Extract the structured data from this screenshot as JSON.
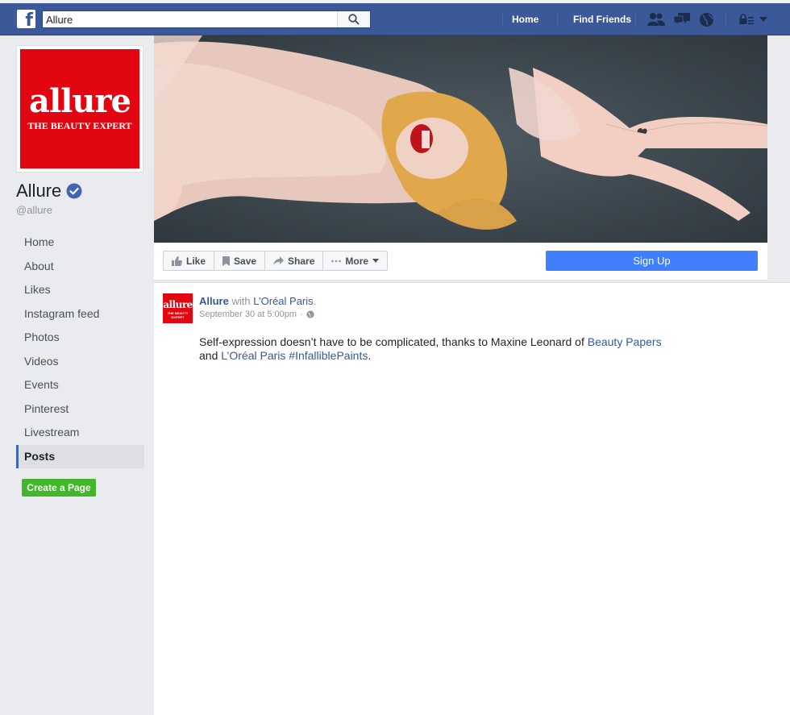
{
  "navbar": {
    "search_value": "Allure",
    "links": {
      "home": "Home",
      "find_friends": "Find Friends"
    }
  },
  "page": {
    "logo_word": "allure",
    "logo_tagline": "THE BEAUTY EXPERT",
    "name": "Allure",
    "handle": "@allure"
  },
  "sidebar": {
    "items": [
      {
        "label": "Home",
        "active": false
      },
      {
        "label": "About",
        "active": false
      },
      {
        "label": "Likes",
        "active": false
      },
      {
        "label": "Instagram feed",
        "active": false
      },
      {
        "label": "Photos",
        "active": false
      },
      {
        "label": "Videos",
        "active": false
      },
      {
        "label": "Events",
        "active": false
      },
      {
        "label": "Pinterest",
        "active": false
      },
      {
        "label": "Livestream",
        "active": false
      },
      {
        "label": "Posts",
        "active": true
      }
    ],
    "create_page": "Create a Page"
  },
  "actions": {
    "like": "Like",
    "save": "Save",
    "share": "Share",
    "more": "More",
    "signup": "Sign Up"
  },
  "post": {
    "author": "Allure",
    "with_text": "with",
    "tagged": "L’Oréal Paris",
    "time": "September 30 at 5:00pm",
    "body_1": "Self-expression doesn’t have to be complicated, thanks to Maxine Leonard of ",
    "body_link_1": "Beauty Papers",
    "body_2": "and ",
    "body_link_2": "L’Oréal Paris",
    "body_link_3": "#InfalliblePaints",
    "body_end": "."
  },
  "colors": {
    "brand_blue": "#3b5998",
    "allure_red": "#e20611",
    "signup_blue": "#4080ff",
    "create_green": "#42b72a"
  }
}
